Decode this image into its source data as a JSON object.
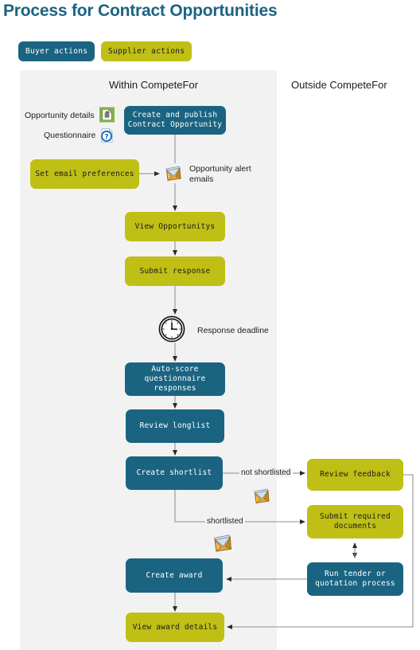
{
  "page": {
    "title": "Process for Contract Opportunities",
    "title_color": "#1c6382",
    "background": "#ffffff"
  },
  "legend": {
    "items": [
      {
        "name": "buyer",
        "label": "Buyer actions",
        "color": "#1a6482",
        "text_color": "#ffffff"
      },
      {
        "name": "supplier",
        "label": "Supplier actions",
        "color": "#bfbf16",
        "text_color": "#1b1b1b"
      }
    ]
  },
  "lanes": {
    "panel_color": "#f2f2f2",
    "within_label": "Within CompeteFor",
    "outside_label": "Outside CompeteFor"
  },
  "nodes": {
    "create_publish": {
      "label": "Create and publish\nContract  Opportunity",
      "actor": "buyer"
    },
    "set_email": {
      "label": "Set email preferences",
      "actor": "supplier"
    },
    "view_opportunitys": {
      "label": "View Opportunitys",
      "actor": "supplier"
    },
    "submit_response": {
      "label": "Submit response",
      "actor": "supplier"
    },
    "auto_score": {
      "label": "Auto-score\nquestionnaire\nresponses",
      "actor": "buyer"
    },
    "review_longlist": {
      "label": "Review longlist",
      "actor": "buyer"
    },
    "create_shortlist": {
      "label": "Create shortlist",
      "actor": "buyer"
    },
    "create_award": {
      "label": "Create award",
      "actor": "buyer"
    },
    "view_award_details": {
      "label": "View award details",
      "actor": "supplier"
    },
    "review_feedback": {
      "label": "Review feedback",
      "actor": "supplier"
    },
    "submit_required_documents": {
      "label": "Submit required\ndocuments",
      "actor": "supplier"
    },
    "run_tender": {
      "label": "Run tender or\nquotation process",
      "actor": "buyer"
    }
  },
  "labels": {
    "opportunity_details": "Opportunity details",
    "questionnaire": "Questionnaire",
    "opportunity_alert_emails": "Opportunity alert emails",
    "response_deadline": "Response deadline",
    "not_shortlisted": "not shortlisted",
    "shortlisted": "shortlisted"
  },
  "icons": {
    "opportunity_details": "document-green-icon",
    "questionnaire": "question-document-icon",
    "alert_envelope": "envelope-icon",
    "deadline": "clock-icon",
    "not_shortlisted_envelope": "envelope-icon",
    "shortlisted_envelope": "envelope-icon"
  },
  "colors": {
    "buyer": "#1a6482",
    "supplier": "#bfbf16",
    "lane": "#f2f2f2",
    "connector": "#8a8a8a",
    "title": "#1c6382"
  }
}
